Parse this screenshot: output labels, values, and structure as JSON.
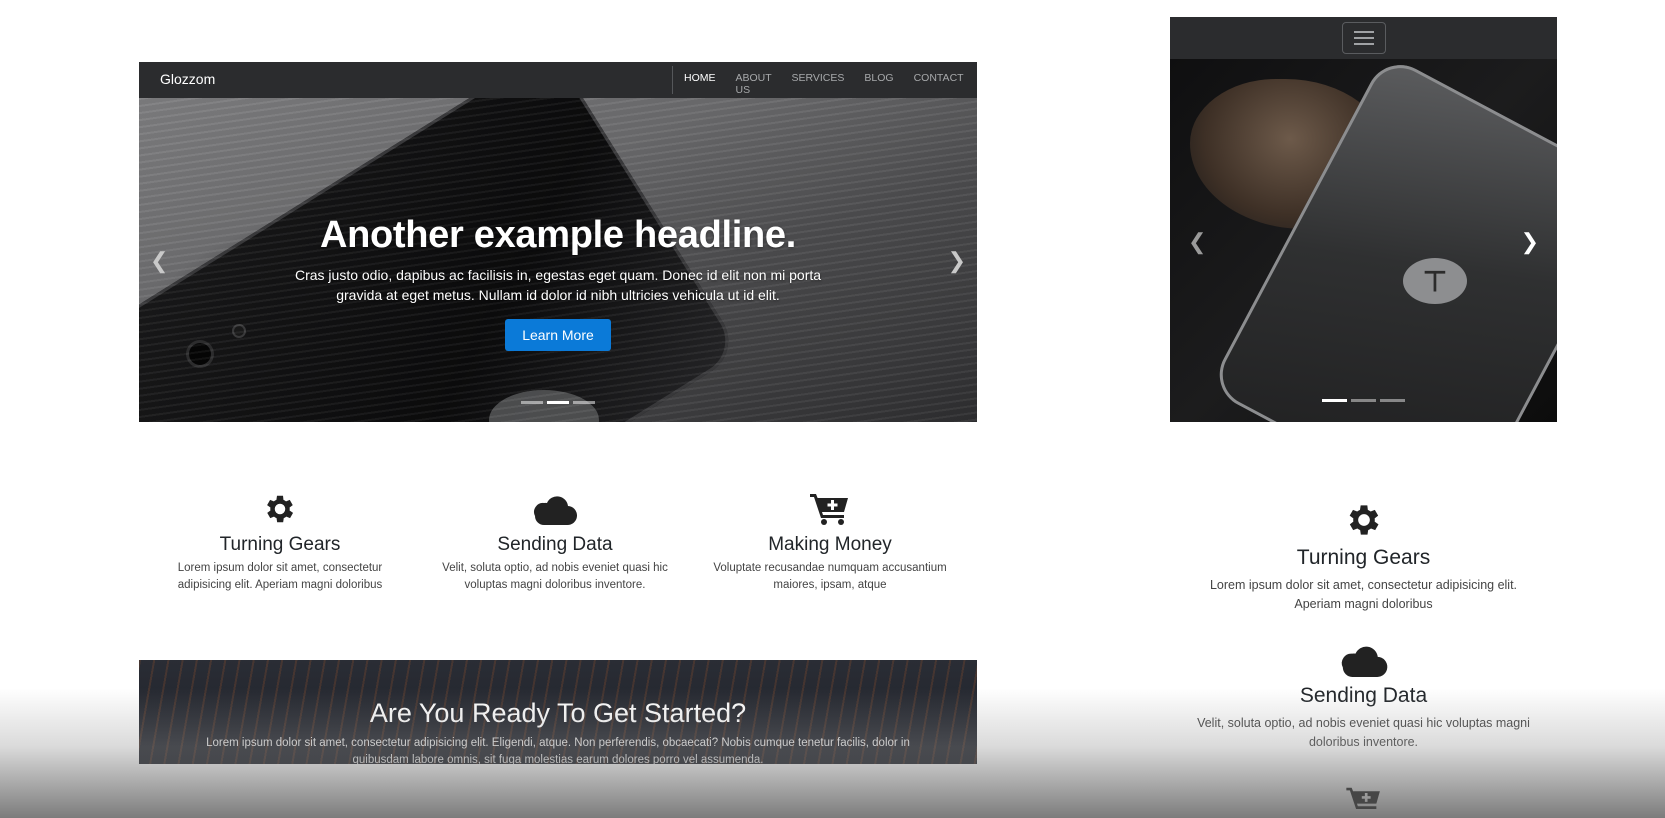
{
  "navbar": {
    "brand": "Glozzom",
    "links": [
      "HOME",
      "ABOUT US",
      "SERVICES",
      "BLOG",
      "CONTACT"
    ],
    "active": "HOME"
  },
  "hero": {
    "headline": "Another example headline.",
    "text": "Cras justo odio, dapibus ac facilisis in, egestas eget quam. Donec id elit non mi porta gravida at eget metus. Nullam id dolor id nibh ultricies vehicula ut id elit.",
    "button": "Learn More",
    "prev_icon": "chevron-left-icon",
    "next_icon": "chevron-right-icon",
    "slides": 3,
    "active_slide": 2
  },
  "features": [
    {
      "icon": "gear-icon",
      "title": "Turning Gears",
      "text": "Lorem ipsum dolor sit amet, consectetur adipisicing elit. Aperiam magni doloribus"
    },
    {
      "icon": "cloud-icon",
      "title": "Sending Data",
      "text": "Velit, soluta optio, ad nobis eveniet quasi hic voluptas magni doloribus inventore."
    },
    {
      "icon": "cart-plus-icon",
      "title": "Making Money",
      "text": "Voluptate recusandae numquam accusantium maiores, ipsam, atque"
    }
  ],
  "cta": {
    "title": "Are You Ready To Get Started?",
    "text": "Lorem ipsum dolor sit amet, consectetur adipisicing elit. Eligendi, atque. Non perferendis, obcaecati? Nobis cumque tenetur facilis, dolor in quibusdam labore omnis, sit fuga molestias earum dolores porro vel assumenda."
  },
  "mobile": {
    "toggler_icon": "hamburger-icon",
    "active_slide": 1,
    "features": [
      {
        "icon": "gear-icon",
        "title": "Turning Gears",
        "text": "Lorem ipsum dolor sit amet, consectetur adipisicing elit. Aperiam magni doloribus"
      },
      {
        "icon": "cloud-icon",
        "title": "Sending Data",
        "text": "Velit, soluta optio, ad nobis eveniet quasi hic voluptas magni doloribus inventore."
      },
      {
        "icon": "cart-plus-icon",
        "title": "",
        "text": ""
      }
    ]
  },
  "colors": {
    "navbar": "#2b2c2e",
    "primary": "#0b7ad8",
    "text": "#212529"
  }
}
